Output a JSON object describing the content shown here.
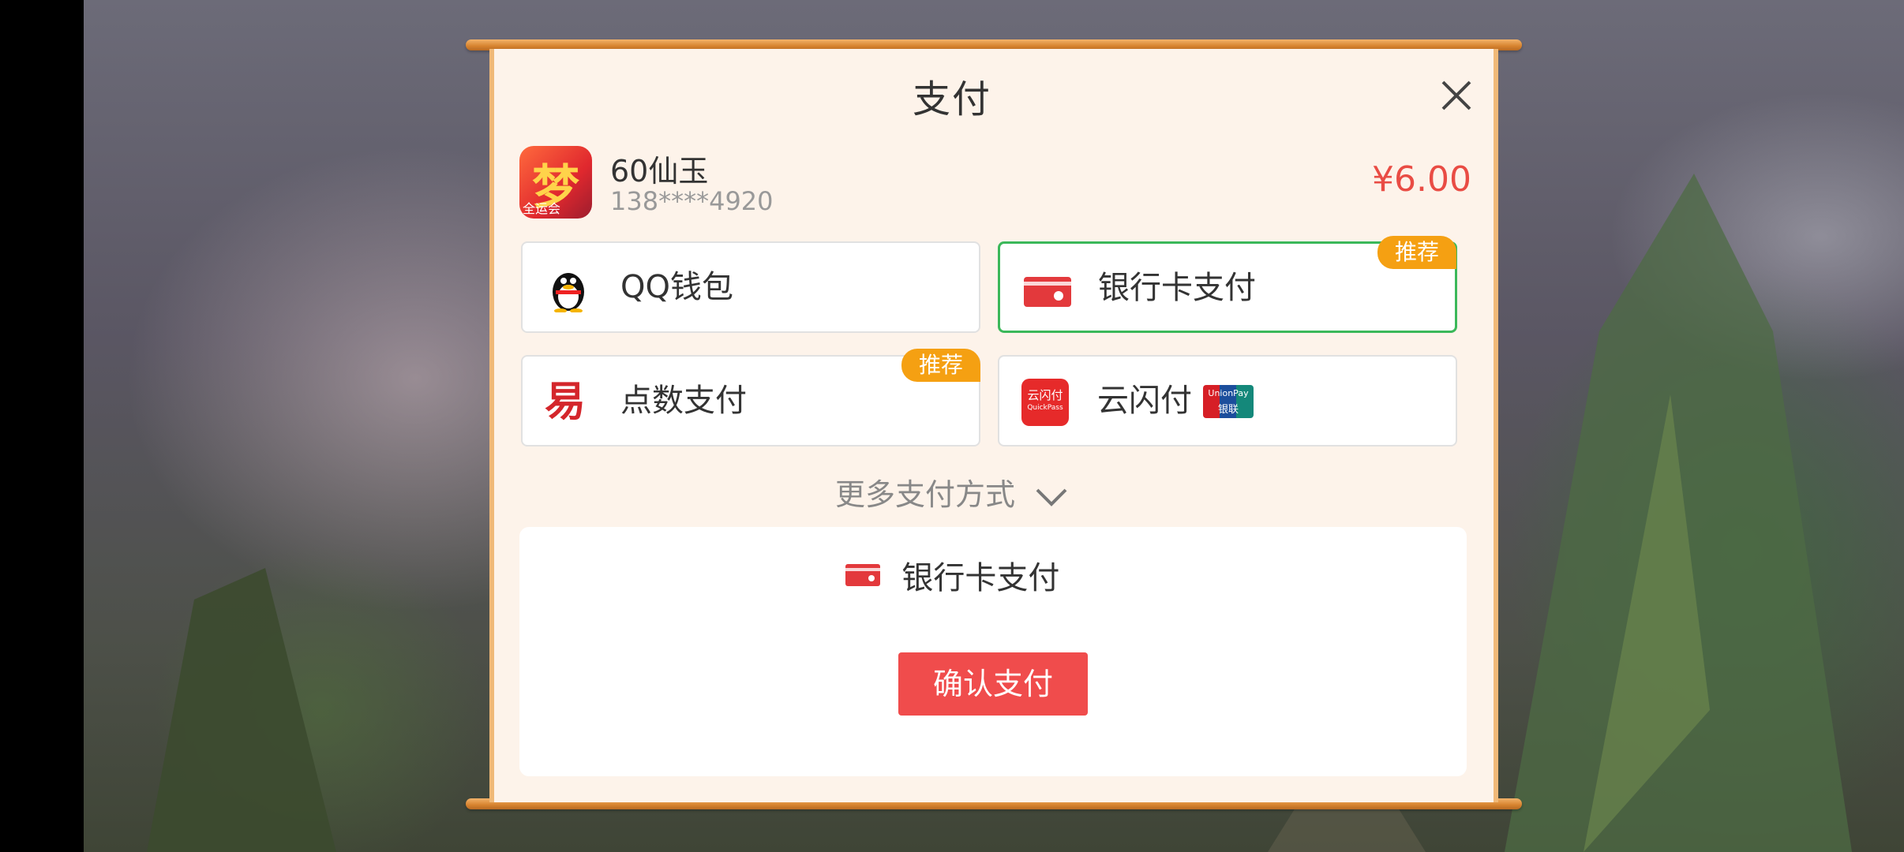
{
  "dialog": {
    "title": "支付",
    "close_icon": "close-icon"
  },
  "product": {
    "app_icon_text": "梦",
    "app_icon_sub": "全运会",
    "name": "60仙玉",
    "account": "138****4920",
    "price": "¥6.00"
  },
  "payment_options": [
    {
      "label": "QQ钱包",
      "icon": "qq-penguin-icon",
      "badge": "",
      "selected": false
    },
    {
      "label": "银行卡支付",
      "icon": "bank-card-icon",
      "badge": "推荐",
      "selected": true
    },
    {
      "label": "点数支付",
      "icon": "yi-points-icon",
      "badge": "推荐",
      "selected": false
    },
    {
      "label": "云闪付",
      "icon": "cloud-quickpass-icon",
      "badge": "",
      "selected": false
    }
  ],
  "cloudpay_icon_text": "云闪付",
  "cloudpay_icon_sub": "QuickPass",
  "unionpay_text": "UnionPay",
  "unionpay_sub": "银联",
  "yi_glyph": "易",
  "more_methods": "更多支付方式",
  "summary": {
    "method": "银行卡支付",
    "confirm_button": "确认支付"
  },
  "colors": {
    "price": "#e94c44",
    "selected_border": "#3bb85a",
    "badge": "#f5a012",
    "confirm": "#f04c4c"
  }
}
